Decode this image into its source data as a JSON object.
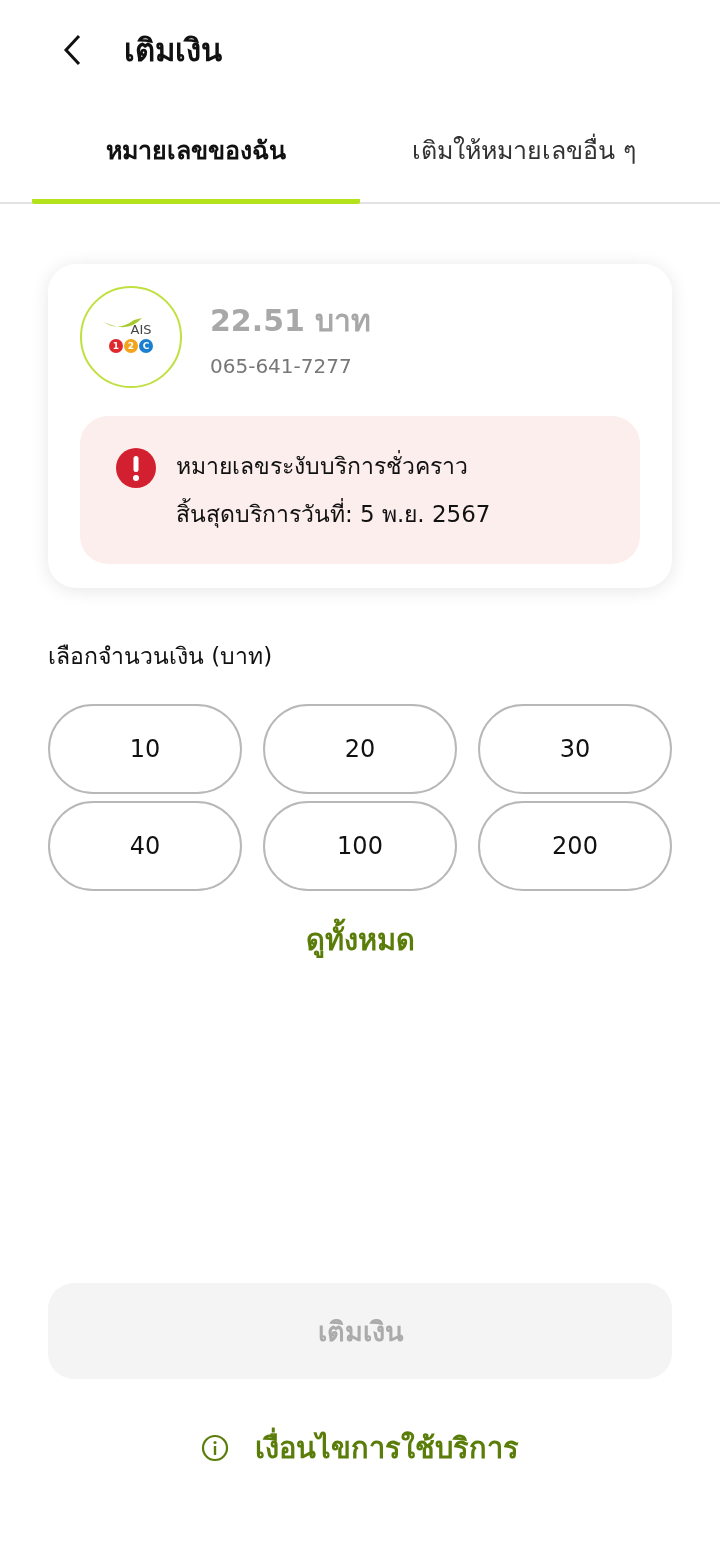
{
  "header": {
    "title": "เติมเงิน"
  },
  "tabs": [
    {
      "label": "หมายเลขของฉัน",
      "selected": true
    },
    {
      "label": "เติมให้หมายเลขอื่น ๆ",
      "selected": false
    }
  ],
  "account": {
    "logo": {
      "brand": "AIS",
      "badges": [
        {
          "text": "1",
          "color": "#e0282e"
        },
        {
          "text": "2",
          "color": "#f2a51c"
        },
        {
          "text": "C",
          "color": "#1a7fd0"
        }
      ]
    },
    "balance": "22.51 บาท",
    "phone": "065-641-7277",
    "alert": {
      "lines": [
        "หมายเลขระงับบริการชั่วคราว",
        "สิ้นสุดบริการวันที่: 5 พ.ย. 2567"
      ]
    }
  },
  "amount_label": "เลือกจำนวนเงิน (บาท)",
  "amounts": [
    {
      "label": "10",
      "selected": false
    },
    {
      "label": "20",
      "selected": false
    },
    {
      "label": "30",
      "selected": false
    },
    {
      "label": "40",
      "selected": false
    },
    {
      "label": "100",
      "selected": false
    },
    {
      "label": "200",
      "selected": false
    }
  ],
  "see_all": "ดูทั้งหมด",
  "submit": {
    "label": "เติมเงิน",
    "disabled": true
  },
  "terms": "เงื่อนไขการใช้บริการ"
}
